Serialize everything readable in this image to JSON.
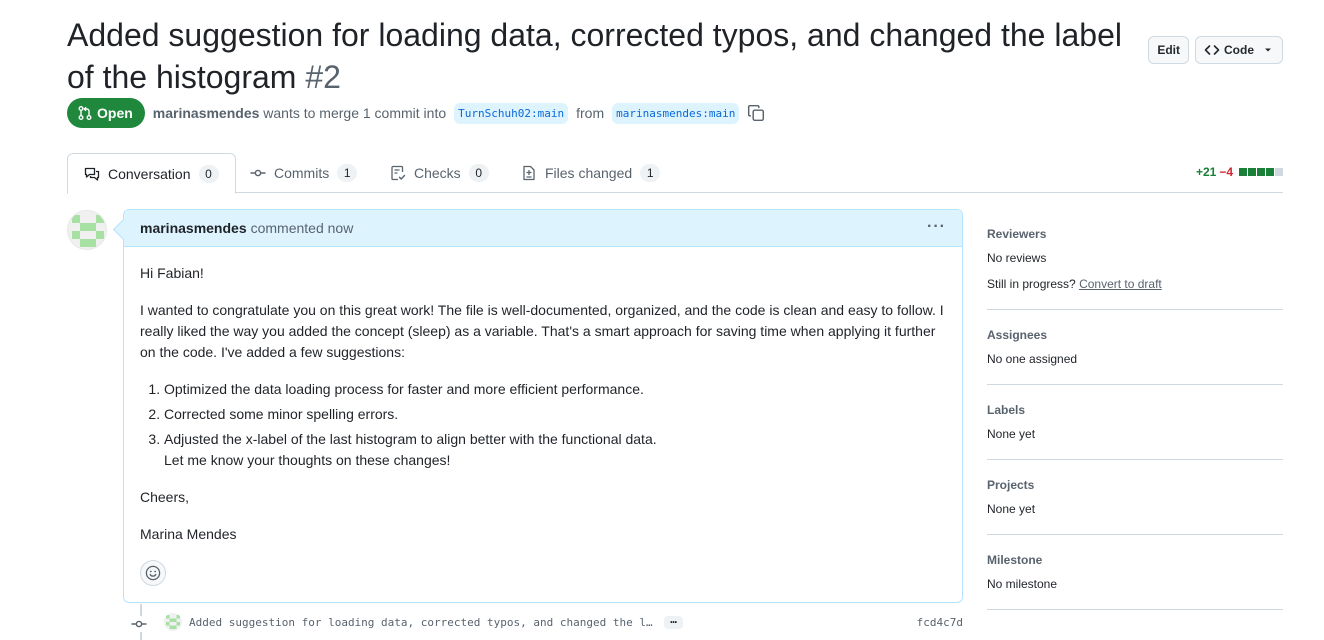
{
  "pr": {
    "title": "Added suggestion for loading data, corrected typos, and changed the label of the histogram",
    "number": "#2",
    "edit_label": "Edit",
    "code_label": "Code",
    "state": "Open",
    "author": "marinasmendes",
    "merge_text": "wants to merge 1 commit into",
    "base_branch": "TurnSchuh02:main",
    "from_text": "from",
    "head_branch": "marinasmendes:main"
  },
  "tabs": [
    {
      "label": "Conversation",
      "count": "0"
    },
    {
      "label": "Commits",
      "count": "1"
    },
    {
      "label": "Checks",
      "count": "0"
    },
    {
      "label": "Files changed",
      "count": "1"
    }
  ],
  "diffstat": {
    "additions": "+21",
    "deletions": "−4",
    "colors": [
      "#1a7f37",
      "#1a7f37",
      "#1a7f37",
      "#1a7f37",
      "#d1d9e0"
    ]
  },
  "comment": {
    "author": "marinasmendes",
    "meta": "commented now",
    "greeting": "Hi Fabian!",
    "paragraph": "I wanted to congratulate you on this great work! The file is well-documented, organized, and the code is clean and easy to follow. I really liked the way you added the concept (sleep) as a variable. That's a smart approach for saving time when applying it further on the code. I've added a few suggestions:",
    "items": [
      "Optimized the data loading process for faster and more efficient performance.",
      "Corrected some minor spelling errors.",
      "Adjusted the x-label of the last histogram to align better with the functional data."
    ],
    "followup": "Let me know your thoughts on these changes!",
    "closing": "Cheers,",
    "signature": "Marina Mendes"
  },
  "commit": {
    "message": "Added suggestion for loading data, corrected typos, and changed the l…",
    "ellipsis": "…",
    "sha": "fcd4c7d"
  },
  "sidebar": {
    "reviewers_heading": "Reviewers",
    "reviewers_value": "No reviews",
    "progress_text": "Still in progress?",
    "convert_link": "Convert to draft",
    "assignees_heading": "Assignees",
    "assignees_value": "No one assigned",
    "labels_heading": "Labels",
    "labels_value": "None yet",
    "projects_heading": "Projects",
    "projects_value": "None yet",
    "milestone_heading": "Milestone",
    "milestone_value": "No milestone"
  },
  "colors": {
    "open_green": "#1f883d",
    "link_blue": "#0969da",
    "header_blue": "#ddf4ff"
  }
}
